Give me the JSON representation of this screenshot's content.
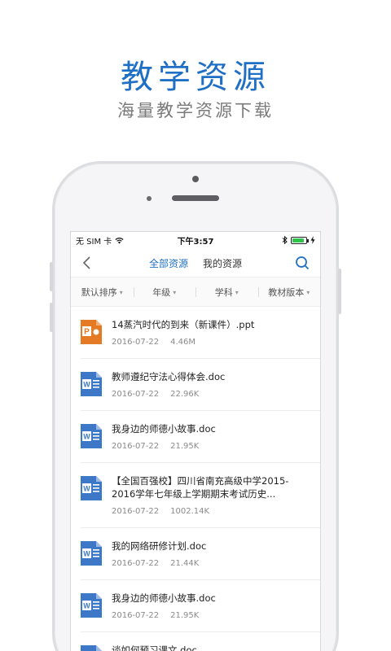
{
  "hero": {
    "title": "教学资源",
    "subtitle": "海量教学资源下载"
  },
  "statusbar": {
    "carrier": "无 SIM 卡",
    "time": "下午3:57"
  },
  "navbar": {
    "tabs": [
      {
        "label": "全部资源",
        "active": true
      },
      {
        "label": "我的资源",
        "active": false
      }
    ]
  },
  "filters": [
    {
      "label": "默认排序"
    },
    {
      "label": "年级"
    },
    {
      "label": "学科"
    },
    {
      "label": "教材版本"
    }
  ],
  "colors": {
    "accent": "#1f6fc5",
    "ppt": "#e57a25",
    "word": "#3d78c8"
  },
  "items": [
    {
      "type": "ppt",
      "title": "14蒸汽时代的到来（新课件）.ppt",
      "date": "2016-07-22",
      "size": "4.46M"
    },
    {
      "type": "doc",
      "title": "教师遵纪守法心得体会.doc",
      "date": "2016-07-22",
      "size": "22.96K"
    },
    {
      "type": "doc",
      "title": "我身边的师德小故事.doc",
      "date": "2016-07-22",
      "size": "21.95K"
    },
    {
      "type": "doc",
      "title": "【全国百强校】四川省南充高级中学2015-2016学年七年级上学期期末考试历史...",
      "date": "2016-07-22",
      "size": "1002.14K"
    },
    {
      "type": "doc",
      "title": "我的网络研修计划.doc",
      "date": "2016-07-22",
      "size": "21.44K"
    },
    {
      "type": "doc",
      "title": "我身边的师德小故事.doc",
      "date": "2016-07-22",
      "size": "21.95K"
    },
    {
      "type": "doc",
      "title": "谈如何预习课文.doc",
      "date": "",
      "size": ""
    }
  ]
}
